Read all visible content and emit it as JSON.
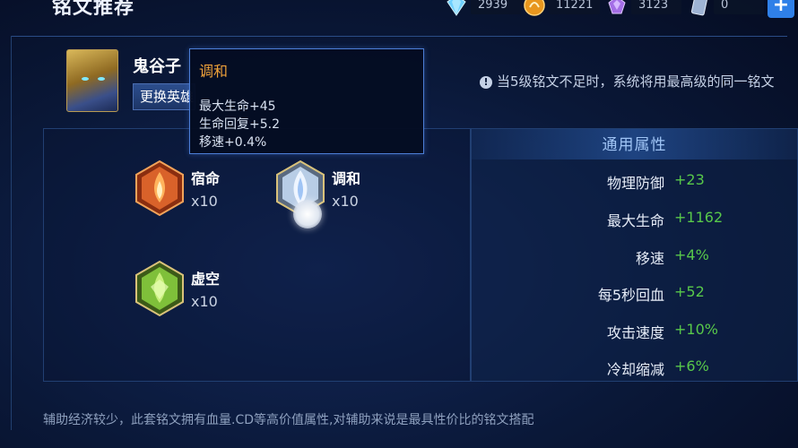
{
  "header": {
    "title": "铭文推荐",
    "resources": [
      {
        "icon": "diamond-crystal-icon",
        "value": "2939"
      },
      {
        "icon": "coin-icon",
        "value": "11221"
      },
      {
        "icon": "purple-gem-icon",
        "value": "3123"
      },
      {
        "icon": "silver-card-icon",
        "value": "0"
      }
    ],
    "plus_label": "+"
  },
  "hero": {
    "name": "鬼谷子",
    "switch_button": "更换英雄"
  },
  "tooltip": {
    "title": "调和",
    "lines": [
      "最大生命+45",
      "生命回复+5.2",
      "移速+0.4%"
    ]
  },
  "notice": "当5级铭文不足时，系统将用最高级的同一铭文",
  "runes": [
    {
      "name": "宿命",
      "count": "x10",
      "color": "#d9622a"
    },
    {
      "name": "调和",
      "count": "x10",
      "color": "#b8cde6"
    },
    {
      "name": "虚空",
      "count": "x10",
      "color": "#7fc03a"
    }
  ],
  "attributes": {
    "header": "通用属性",
    "rows": [
      {
        "label": "物理防御",
        "value": "+23"
      },
      {
        "label": "最大生命",
        "value": "+1162"
      },
      {
        "label": "移速",
        "value": "+4%"
      },
      {
        "label": "每5秒回血",
        "value": "+52"
      },
      {
        "label": "攻击速度",
        "value": "+10%"
      },
      {
        "label": "冷却缩减",
        "value": "+6%"
      }
    ]
  },
  "footer": "辅助经济较少，此套铭文拥有血量.CD等高价值属性,对辅助来说是最具性价比的铭文搭配",
  "colors": {
    "accent": "#2f80e8",
    "positive": "#58c84a",
    "tooltip_title": "#f0a23a"
  }
}
